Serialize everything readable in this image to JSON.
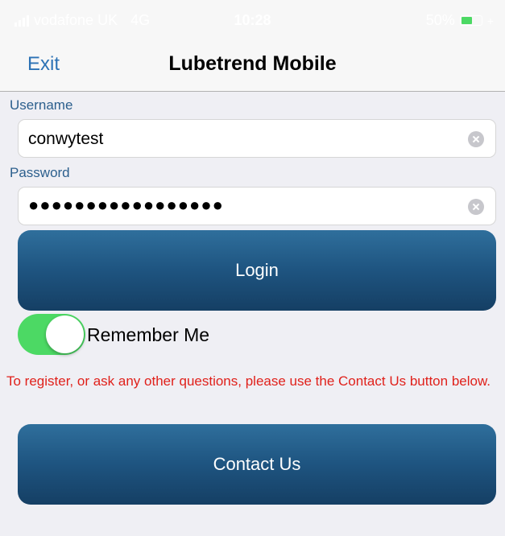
{
  "status": {
    "carrier": "vodafone UK",
    "network": "4G",
    "time": "10:28",
    "battery_percent_text": "50%",
    "battery_level": 0.5,
    "battery_color": "#4cd964"
  },
  "nav": {
    "exit_label": "Exit",
    "title": "Lubetrend Mobile"
  },
  "form": {
    "username_label": "Username",
    "username_value": "conwytest",
    "password_label": "Password",
    "password_mask": "●●●●●●●●●●●●●●●●●"
  },
  "login_button": "Login",
  "remember": {
    "label": "Remember Me",
    "on": true,
    "toggle_color": "#4cd964"
  },
  "info_text": "To register, or ask any other questions, please use the Contact Us button below.",
  "contact_button": "Contact Us",
  "colors": {
    "accent": "#2c72b5",
    "button": "#1e5480",
    "warning": "#e0211b"
  }
}
